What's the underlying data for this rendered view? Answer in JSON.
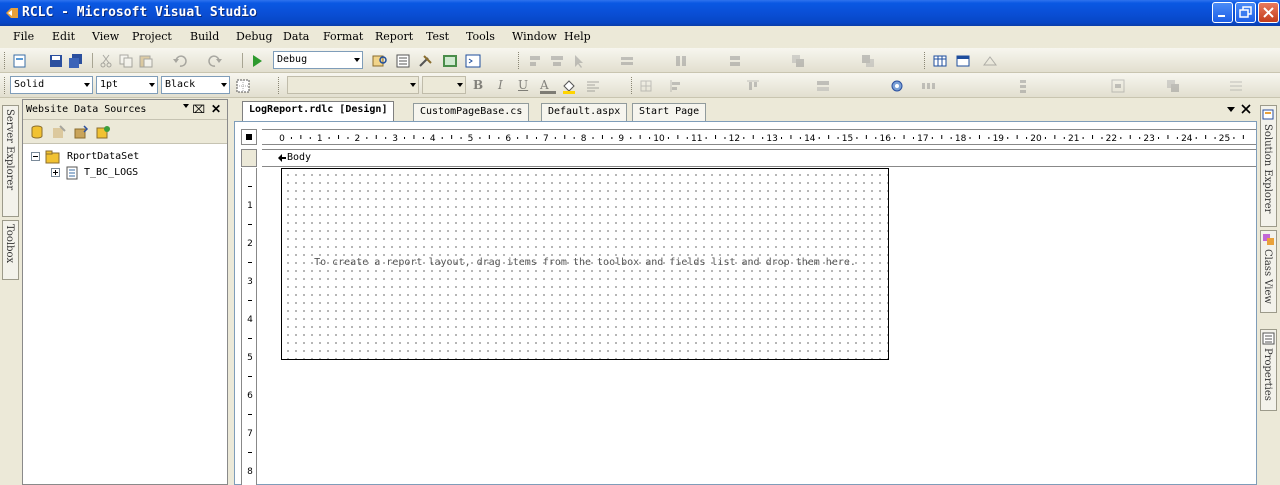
{
  "window": {
    "title": "RCLC - Microsoft Visual Studio"
  },
  "menu": [
    "File",
    "Edit",
    "View",
    "Project",
    "Build",
    "Debug",
    "Data",
    "Format",
    "Report",
    "Test",
    "Tools",
    "Window",
    "Help"
  ],
  "toolbar": {
    "config_value": "Debug"
  },
  "format_toolbar": {
    "border_style": "Solid",
    "border_width": "1pt",
    "border_color": "Black",
    "bold": "B",
    "italic": "I",
    "underline": "U",
    "strike": "A"
  },
  "left_tabs": {
    "server_explorer": "Server Explorer",
    "toolbox": "Toolbox"
  },
  "panel": {
    "title": "Website Data Sources",
    "pin": "⌧",
    "close": "✕"
  },
  "tree": {
    "dataset": "RportDataSet",
    "table": "T_BC_LOGS"
  },
  "tabs": [
    "LogReport.rdlc [Design]",
    "CustomPageBase.cs",
    "Default.aspx",
    "Start Page"
  ],
  "report": {
    "body_label": "Body",
    "hint": "To create a report layout, drag items from the toolbox and fields list and drop them here.",
    "ruler_h": [
      "0",
      "1",
      "2",
      "3",
      "4",
      "5",
      "6",
      "7",
      "8",
      "9",
      "10",
      "11",
      "12",
      "13",
      "14",
      "15",
      "16",
      "17",
      "18",
      "19",
      "20",
      "21",
      "22",
      "23",
      "24",
      "25"
    ],
    "ruler_v": [
      "1",
      "2",
      "3",
      "4",
      "5",
      "6",
      "7",
      "8"
    ]
  },
  "right_tabs": {
    "solution_explorer": "Solution Explorer",
    "class_view": "Class View",
    "properties": "Properties"
  },
  "colors": {
    "titlebar": "#0a4fd6",
    "chrome": "#ece9d8"
  }
}
